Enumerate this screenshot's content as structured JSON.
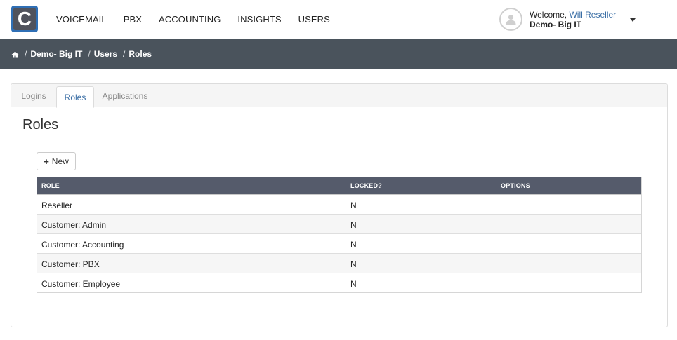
{
  "nav": {
    "logo_letter": "C",
    "items": [
      "VOICEMAIL",
      "PBX",
      "ACCOUNTING",
      "INSIGHTS",
      "USERS"
    ]
  },
  "user": {
    "welcome_prefix": "Welcome,",
    "name": "Will Reseller",
    "account": "Demo- Big IT"
  },
  "breadcrumb": {
    "items": [
      "Demo- Big IT",
      "Users",
      "Roles"
    ]
  },
  "tabs": [
    "Logins",
    "Roles",
    "Applications"
  ],
  "active_tab": "Roles",
  "page": {
    "title": "Roles",
    "new_button": "New"
  },
  "table": {
    "headers": [
      "ROLE",
      "LOCKED?",
      "OPTIONS"
    ],
    "rows": [
      {
        "role": "Reseller",
        "locked": "N"
      },
      {
        "role": "Customer: Admin",
        "locked": "N"
      },
      {
        "role": "Customer: Accounting",
        "locked": "N"
      },
      {
        "role": "Customer: PBX",
        "locked": "N"
      },
      {
        "role": "Customer: Employee",
        "locked": "N"
      }
    ]
  },
  "colors": {
    "breadcrumb_bg": "#4a535c",
    "table_header_bg": "#555b6b",
    "link": "#3a6ea5",
    "logo_border": "#2f6fb5"
  }
}
